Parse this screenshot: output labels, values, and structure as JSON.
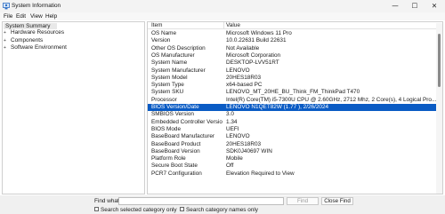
{
  "window": {
    "title": "System Information",
    "controls": {
      "minimize": "—",
      "maximize": "☐",
      "close": "✕"
    }
  },
  "menu": [
    "File",
    "Edit",
    "View",
    "Help"
  ],
  "tree": {
    "root": "System Summary",
    "children": [
      {
        "toggle": "+",
        "label": "Hardware Resources"
      },
      {
        "toggle": "+",
        "label": "Components"
      },
      {
        "toggle": "+",
        "label": "Software Environment"
      }
    ]
  },
  "table": {
    "headers": [
      "Item",
      "Value"
    ],
    "selected_index": 10,
    "rows": [
      [
        "OS Name",
        "Microsoft Windows 11 Pro"
      ],
      [
        "Version",
        "10.0.22631 Build 22631"
      ],
      [
        "Other OS Description",
        "Not Available"
      ],
      [
        "OS Manufacturer",
        "Microsoft Corporation"
      ],
      [
        "System Name",
        "DESKTOP-LVV51RT"
      ],
      [
        "System Manufacturer",
        "LENOVO"
      ],
      [
        "System Model",
        "20HES18R03"
      ],
      [
        "System Type",
        "x64-based PC"
      ],
      [
        "System SKU",
        "LENOVO_MT_20HE_BU_Think_FM_ThinkPad T470"
      ],
      [
        "Processor",
        "Intel(R) Core(TM) i5-7300U CPU @ 2.60GHz, 2712 Mhz, 2 Core(s), 4 Logical Pro..."
      ],
      [
        "BIOS Version/Date",
        "LENOVO N1QET82W (1.77 ), 2/26/2024"
      ],
      [
        "SMBIOS Version",
        "3.0"
      ],
      [
        "Embedded Controller Version",
        "1.34"
      ],
      [
        "BIOS Mode",
        "UEFI"
      ],
      [
        "BaseBoard Manufacturer",
        "LENOVO"
      ],
      [
        "BaseBoard Product",
        "20HES18R03"
      ],
      [
        "BaseBoard Version",
        "SDK0J40697 WIN"
      ],
      [
        "Platform Role",
        "Mobile"
      ],
      [
        "Secure Boot State",
        "Off"
      ],
      [
        "PCR7 Configuration",
        "Elevation Required to View"
      ]
    ]
  },
  "find": {
    "label": "Find what:",
    "value": "",
    "find_button": "Find",
    "close_button": "Close Find",
    "option_selected": "Search selected category only",
    "option_names": "Search category names only"
  }
}
